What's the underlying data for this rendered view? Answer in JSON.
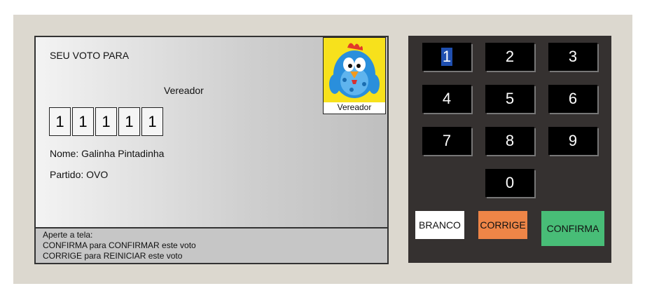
{
  "screen": {
    "title": "SEU VOTO PARA",
    "role": "Vereador",
    "digits": [
      "1",
      "1",
      "1",
      "1",
      "1"
    ],
    "name_line": "Nome: Galinha Pintadinha",
    "party_line": "Partido: OVO",
    "photo_caption": "Vereador",
    "footer": {
      "line1": "Aperte a tela:",
      "line2": "CONFIRMA para CONFIRMAR este voto",
      "line3": "CORRIGE para REINICIAR este voto"
    }
  },
  "keypad": {
    "keys": [
      "1",
      "2",
      "3",
      "4",
      "5",
      "6",
      "7",
      "8",
      "9",
      "0"
    ],
    "branco": "BRANCO",
    "corrige": "CORRIGE",
    "confirma": "CONFIRMA"
  },
  "colors": {
    "branco": "#ffffff",
    "corrige": "#ee8547",
    "confirma": "#48bd77",
    "selection": "#1f4fb0"
  }
}
